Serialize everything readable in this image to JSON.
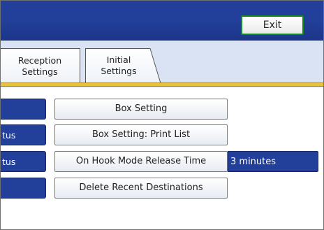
{
  "header": {
    "exit_label": "Exit"
  },
  "tabs": [
    {
      "line1": "Reception",
      "line2": "Settings"
    },
    {
      "line1": "Initial",
      "line2": "Settings"
    }
  ],
  "rows": [
    {
      "side_label": "",
      "button_label": "Box Setting",
      "value": ""
    },
    {
      "side_label": "tus",
      "button_label": "Box Setting: Print List",
      "value": ""
    },
    {
      "side_label": "tus",
      "button_label": "On Hook Mode Release Time",
      "value": "3 minutes"
    },
    {
      "side_label": "",
      "button_label": "Delete Recent Destinations",
      "value": ""
    }
  ],
  "colors": {
    "header_blue": "#22409a",
    "tab_strip": "#d9e3f3",
    "divider_gold": "#e8c23a",
    "exit_border": "#118a1e"
  }
}
